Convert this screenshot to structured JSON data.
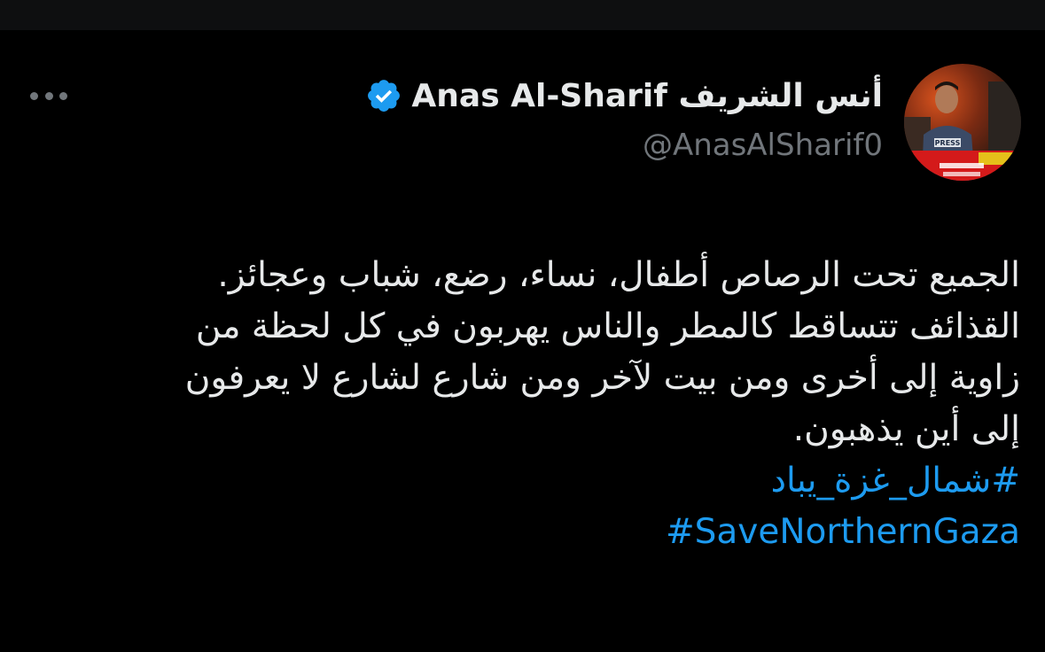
{
  "author": {
    "display_name": "أنس الشريف Anas Al-Sharif",
    "handle": "@AnasAlSharif0",
    "verified": true,
    "avatar_icon": "profile-photo-press-reporter",
    "avatar_caption_lines": [
      "PRESS"
    ]
  },
  "menu": {
    "more_icon": "more-horizontal-icon"
  },
  "tweet": {
    "lines": [
      "الجميع تحت الرصاص أطفال، نساء، رضع، شباب وعجائز.",
      "القذائف تتساقط كالمطر والناس يهربون في كل لحظة من",
      "زاوية إلى أخرى ومن بيت لآخر ومن شارع لشارع لا يعرفون",
      "إلى أين يذهبون."
    ],
    "hashtags": [
      "#شمال_غزة_يباد",
      "#SaveNorthernGaza"
    ]
  },
  "colors": {
    "background": "#000000",
    "text": "#e7e9ea",
    "muted": "#71767b",
    "link": "#1d9bf0",
    "verified_badge": "#1d9bf0"
  }
}
